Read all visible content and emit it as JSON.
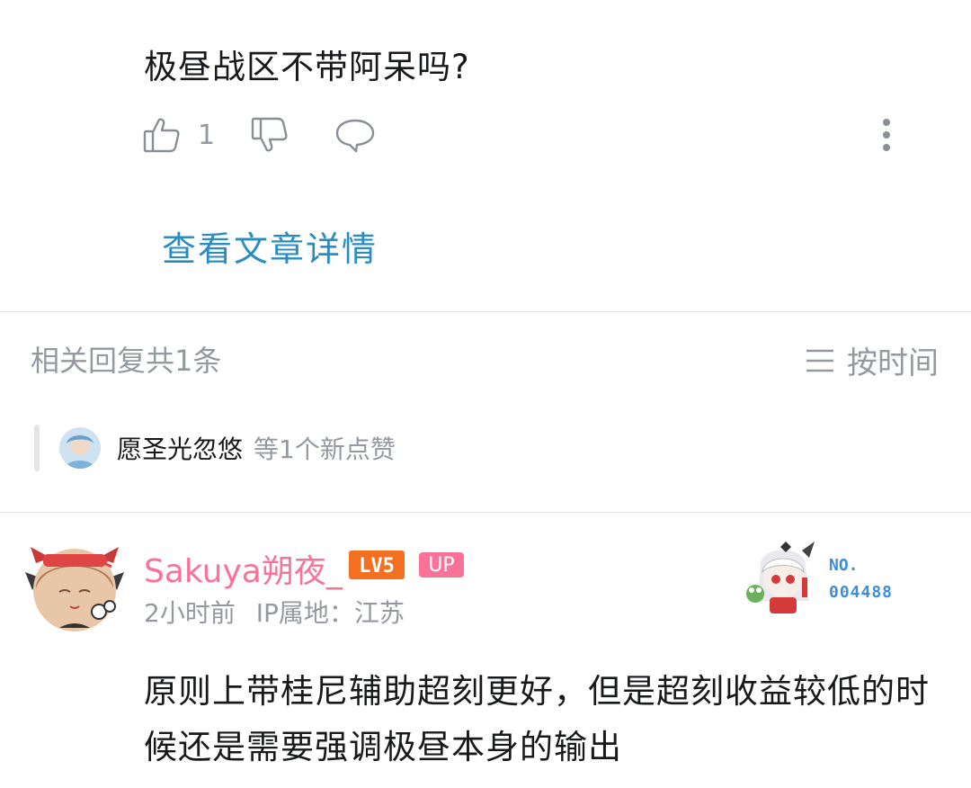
{
  "comment": {
    "text": "极昼战区不带阿呆吗?",
    "like_count": "1",
    "view_article": "查看文章详情"
  },
  "replies": {
    "header": "相关回复共1条",
    "sort_label": "按时间",
    "likers_name": "愿圣光忽悠",
    "likers_suffix": "等1个新点赞"
  },
  "reply": {
    "author": "Sakuya朔夜_",
    "level": "LV5",
    "up_badge": "UP",
    "time": "2小时前",
    "ip": "IP属地：江苏",
    "fan_label": "NO.",
    "fan_number": "004488",
    "text": "原则上带桂尼辅助超刻更好，但是超刻收益较低的时候还是需要强调极昼本身的输出"
  },
  "colors": {
    "link": "#2a8dc2",
    "author": "#fb7299",
    "muted": "#9499a0",
    "level_badge": "#f37021"
  }
}
